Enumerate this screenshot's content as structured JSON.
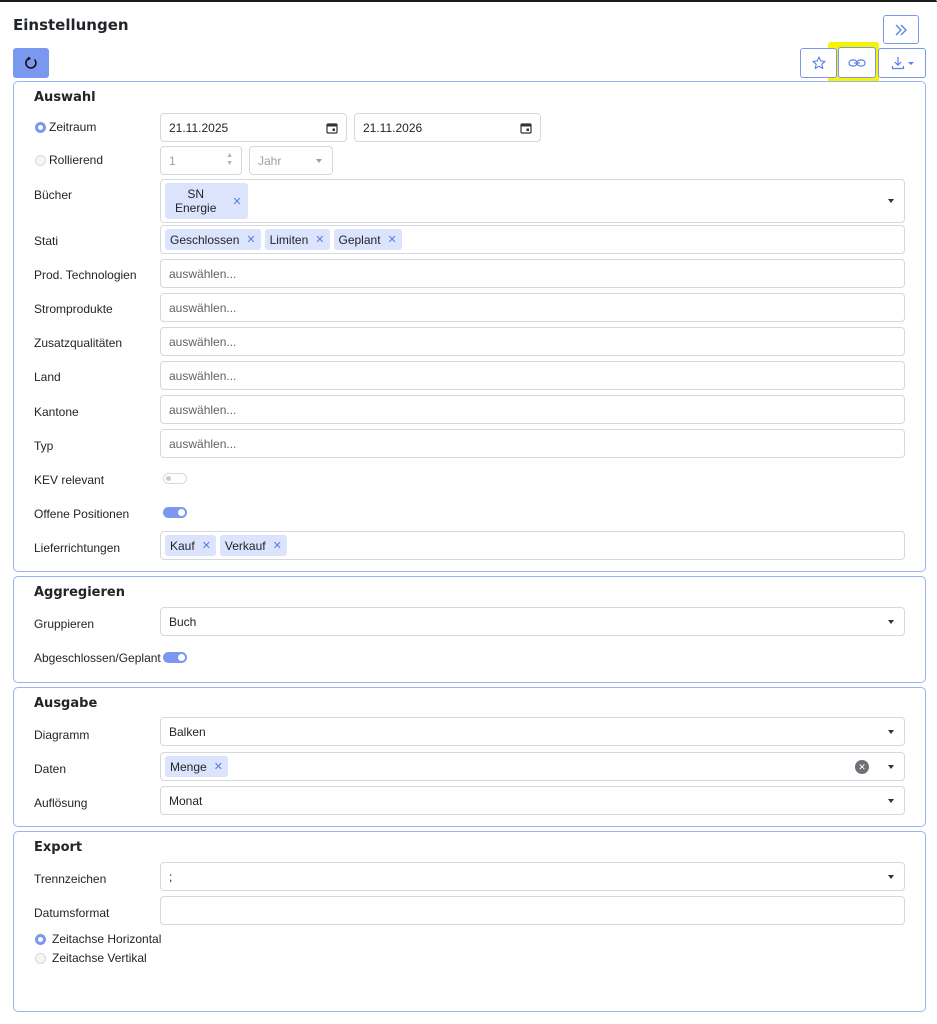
{
  "page": {
    "title": "Einstellungen"
  },
  "icons": {
    "expand": "double-chevron-right-icon",
    "reload": "reload-icon",
    "star": "star-icon",
    "link": "link-icon",
    "download": "download-icon"
  },
  "colors": {
    "accent": "#7b98f0",
    "tag_bg": "#dbe4fc",
    "highlight": "#f7f200"
  },
  "auswahl": {
    "title": "Auswahl",
    "zeitraum": {
      "label": "Zeitraum",
      "from": "21.11.2025",
      "to": "21.11.2026",
      "selected": true
    },
    "rollierend": {
      "label": "Rollierend",
      "count": "1",
      "unit": "Jahr",
      "selected": false
    },
    "buecher": {
      "label": "Bücher",
      "tags": [
        "SN",
        "Energie"
      ]
    },
    "stati": {
      "label": "Stati",
      "tags": [
        "Geschlossen",
        "Limiten",
        "Geplant"
      ]
    },
    "prod_technologien": {
      "label": "Prod. Technologien",
      "placeholder": "auswählen..."
    },
    "stromprodukte": {
      "label": "Stromprodukte",
      "placeholder": "auswählen..."
    },
    "zusatzqualitaeten": {
      "label": "Zusatzqualitäten",
      "placeholder": "auswählen..."
    },
    "land": {
      "label": "Land",
      "placeholder": "auswählen..."
    },
    "kantone": {
      "label": "Kantone",
      "placeholder": "auswählen..."
    },
    "typ": {
      "label": "Typ",
      "placeholder": "auswählen..."
    },
    "kev_relevant": {
      "label": "KEV relevant",
      "on": false
    },
    "offene_positionen": {
      "label": "Offene Positionen",
      "on": true
    },
    "lieferrichtungen": {
      "label": "Lieferrichtungen",
      "tags": [
        "Kauf",
        "Verkauf"
      ]
    }
  },
  "aggregieren": {
    "title": "Aggregieren",
    "gruppieren": {
      "label": "Gruppieren",
      "value": "Buch"
    },
    "abgeschlossen_geplant": {
      "label": "Abgeschlossen/Geplant",
      "on": true
    }
  },
  "ausgabe": {
    "title": "Ausgabe",
    "diagramm": {
      "label": "Diagramm",
      "value": "Balken"
    },
    "daten": {
      "label": "Daten",
      "tags": [
        "Menge"
      ]
    },
    "aufloesung": {
      "label": "Auflösung",
      "value": "Monat"
    }
  },
  "export": {
    "title": "Export",
    "trennzeichen": {
      "label": "Trennzeichen",
      "value": ";"
    },
    "datumsformat": {
      "label": "Datumsformat",
      "value": ""
    },
    "zeitachse_horizontal": {
      "label": "Zeitachse Horizontal",
      "selected": true
    },
    "zeitachse_vertikal": {
      "label": "Zeitachse Vertikal",
      "selected": false
    }
  }
}
